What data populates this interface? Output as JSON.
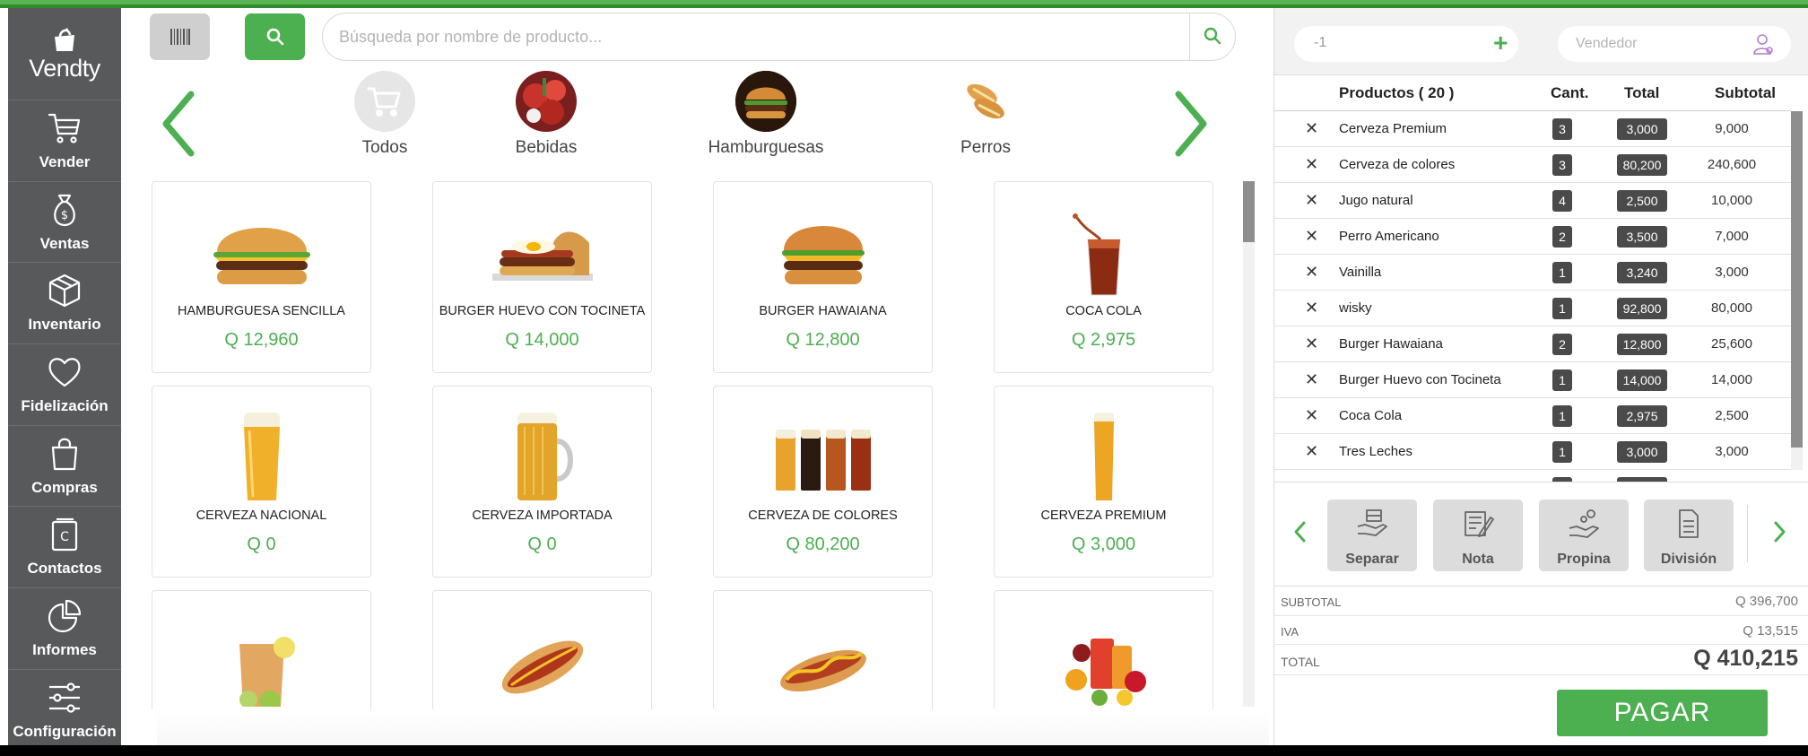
{
  "app": {
    "logo_text": "Vendty"
  },
  "sidebar": {
    "items": [
      {
        "label": "Vender",
        "icon": "cart-icon"
      },
      {
        "label": "Ventas",
        "icon": "money-bag-icon"
      },
      {
        "label": "Inventario",
        "icon": "box-icon"
      },
      {
        "label": "Fidelización",
        "icon": "heart-icon"
      },
      {
        "label": "Compras",
        "icon": "shopping-bag-icon"
      },
      {
        "label": "Contactos",
        "icon": "contacts-book-icon"
      },
      {
        "label": "Informes",
        "icon": "pie-chart-icon"
      },
      {
        "label": "Configuración",
        "icon": "sliders-icon"
      }
    ]
  },
  "search": {
    "placeholder": "Búsqueda por nombre de producto..."
  },
  "categories": [
    {
      "label": "Todos",
      "icon": "cart-icon"
    },
    {
      "label": "Bebidas",
      "icon": "drinks-image"
    },
    {
      "label": "Hamburguesas",
      "icon": "burger-image"
    },
    {
      "label": "Perros",
      "icon": "hotdog-image"
    }
  ],
  "products": [
    {
      "name": "HAMBURGUESA SENCILLA",
      "price": "Q 12,960",
      "image": "burger"
    },
    {
      "name": "BURGER HUEVO CON TOCINETA",
      "price": "Q 14,000",
      "image": "burger-egg"
    },
    {
      "name": "BURGER HAWAIANA",
      "price": "Q 12,800",
      "image": "burger"
    },
    {
      "name": "COCA COLA",
      "price": "Q 2,975",
      "image": "soda"
    },
    {
      "name": "CERVEZA NACIONAL",
      "price": "Q 0",
      "image": "beer-glass"
    },
    {
      "name": "CERVEZA IMPORTADA",
      "price": "Q 0",
      "image": "beer-mug"
    },
    {
      "name": "CERVEZA DE COLORES",
      "price": "Q 80,200",
      "image": "beer-row"
    },
    {
      "name": "CERVEZA PREMIUM",
      "price": "Q 3,000",
      "image": "beer-tall"
    },
    {
      "name": "",
      "price": "",
      "image": "iced-tea"
    },
    {
      "name": "",
      "price": "",
      "image": "hotdog"
    },
    {
      "name": "",
      "price": "",
      "image": "hotdog-mustard"
    },
    {
      "name": "",
      "price": "",
      "image": "fruit-juice"
    }
  ],
  "order": {
    "qty_input": "-1",
    "vendor_placeholder": "Vendedor",
    "headers": {
      "products": "Productos ( 20 )",
      "qty": "Cant.",
      "total": "Total",
      "subtotal": "Subtotal"
    },
    "items": [
      {
        "name": "Cerveza Premium",
        "qty": "3",
        "total": "3,000",
        "subtotal": "9,000"
      },
      {
        "name": "Cerveza de colores",
        "qty": "3",
        "total": "80,200",
        "subtotal": "240,600"
      },
      {
        "name": "Jugo natural",
        "qty": "4",
        "total": "2,500",
        "subtotal": "10,000"
      },
      {
        "name": "Perro Americano",
        "qty": "2",
        "total": "3,500",
        "subtotal": "7,000"
      },
      {
        "name": "Vainilla",
        "qty": "1",
        "total": "3,240",
        "subtotal": "3,000"
      },
      {
        "name": "wisky",
        "qty": "1",
        "total": "92,800",
        "subtotal": "80,000"
      },
      {
        "name": "Burger Hawaiana",
        "qty": "2",
        "total": "12,800",
        "subtotal": "25,600"
      },
      {
        "name": "Burger Huevo con Tocineta",
        "qty": "1",
        "total": "14,000",
        "subtotal": "14,000"
      },
      {
        "name": "Coca Cola",
        "qty": "1",
        "total": "2,975",
        "subtotal": "2,500"
      },
      {
        "name": "Tres Leches",
        "qty": "1",
        "total": "3,000",
        "subtotal": "3,000"
      }
    ],
    "actions": [
      {
        "label": "Separar",
        "icon": "hand-box-icon"
      },
      {
        "label": "Nota",
        "icon": "note-pencil-icon"
      },
      {
        "label": "Propina",
        "icon": "hand-coin-icon"
      },
      {
        "label": "División",
        "icon": "document-icon"
      }
    ],
    "totals": {
      "subtotal_label": "SUBTOTAL",
      "subtotal": "Q 396,700",
      "iva_label": "IVA",
      "iva": "Q 13,515",
      "total_label": "TOTAL",
      "total": "Q 410,215"
    },
    "pay_label": "PAGAR"
  },
  "colors": {
    "accent": "#4caf50",
    "sidebar": "#58595b",
    "badge": "#4a4a4a"
  }
}
